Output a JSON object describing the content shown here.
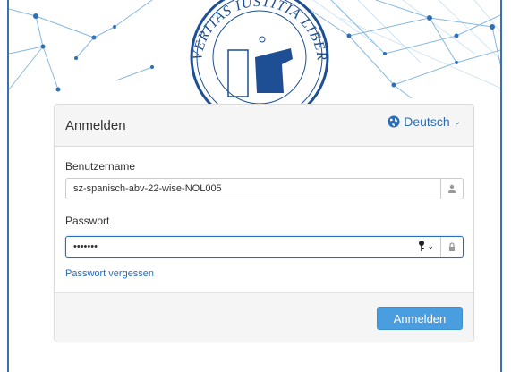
{
  "brand": {
    "seal_text": "VERITAS IUSTITIA LIBERTAS",
    "accent": "#2a6db7",
    "border": "#3a6fb0"
  },
  "login": {
    "title": "Anmelden",
    "language": "Deutsch",
    "username_label": "Benutzername",
    "username_value": "sz-spanisch-abv-22-wise-NOL005",
    "password_label": "Passwort",
    "password_value": "•••••••",
    "forgot_link": "Passwort vergessen",
    "submit_label": "Anmelden"
  },
  "icons": {
    "language": "globe-icon",
    "username": "user-icon",
    "password": "lock-icon",
    "key": "key-icon",
    "dropdown": "chevron-down-icon"
  }
}
